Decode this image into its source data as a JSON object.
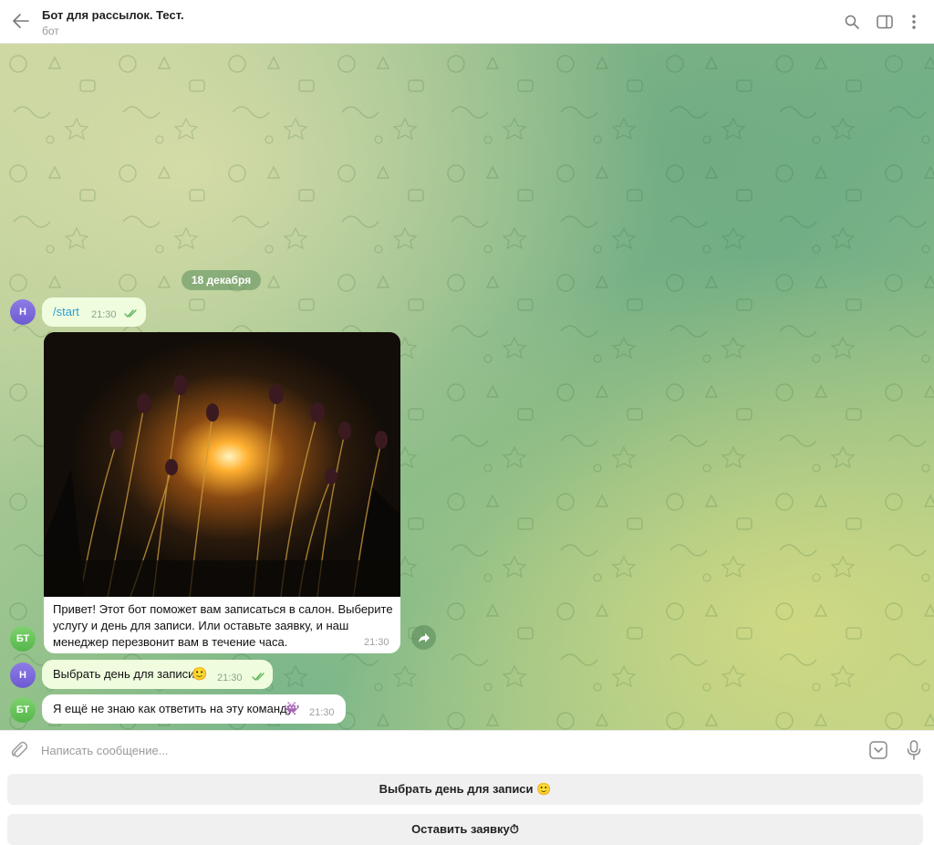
{
  "header": {
    "title": "Бот для рассылок. Тест.",
    "subtitle": "бот",
    "icons": [
      "back-arrow-icon",
      "search-icon",
      "sidebar-toggle-icon",
      "more-vertical-icon"
    ]
  },
  "chat": {
    "date_separator": "18 декабря",
    "messages": [
      {
        "sender_initials": "Н",
        "text": "/start",
        "time": "21:30",
        "direction": "out",
        "status": "read"
      },
      {
        "sender_initials": "БТ",
        "photo": true,
        "caption": "Привет! Этот бот поможет вам записаться в салон. Выберите услугу и день для записи. Или оставьте заявку, и наш менеджер перезвонит вам в течение часа.",
        "time": "21:30",
        "direction": "in"
      },
      {
        "sender_initials": "Н",
        "text": "Выбрать день для записи",
        "emoji": "🙂",
        "time": "21:30",
        "direction": "out",
        "status": "read"
      },
      {
        "sender_initials": "БТ",
        "text": "Я ещё не знаю как ответить на эту команду",
        "emoji": "👾",
        "time": "21:30",
        "direction": "in"
      }
    ]
  },
  "composer": {
    "placeholder": "Написать сообщение..."
  },
  "keyboard": {
    "buttons": [
      {
        "label": "Выбрать день для записи 🙂"
      },
      {
        "label": "Оставить заявку⏱"
      }
    ]
  },
  "colors": {
    "outgoing_bubble": "#effdde",
    "incoming_bubble": "#ffffff",
    "accent_link": "#2f9fd6",
    "read_check": "#5fb55a"
  }
}
